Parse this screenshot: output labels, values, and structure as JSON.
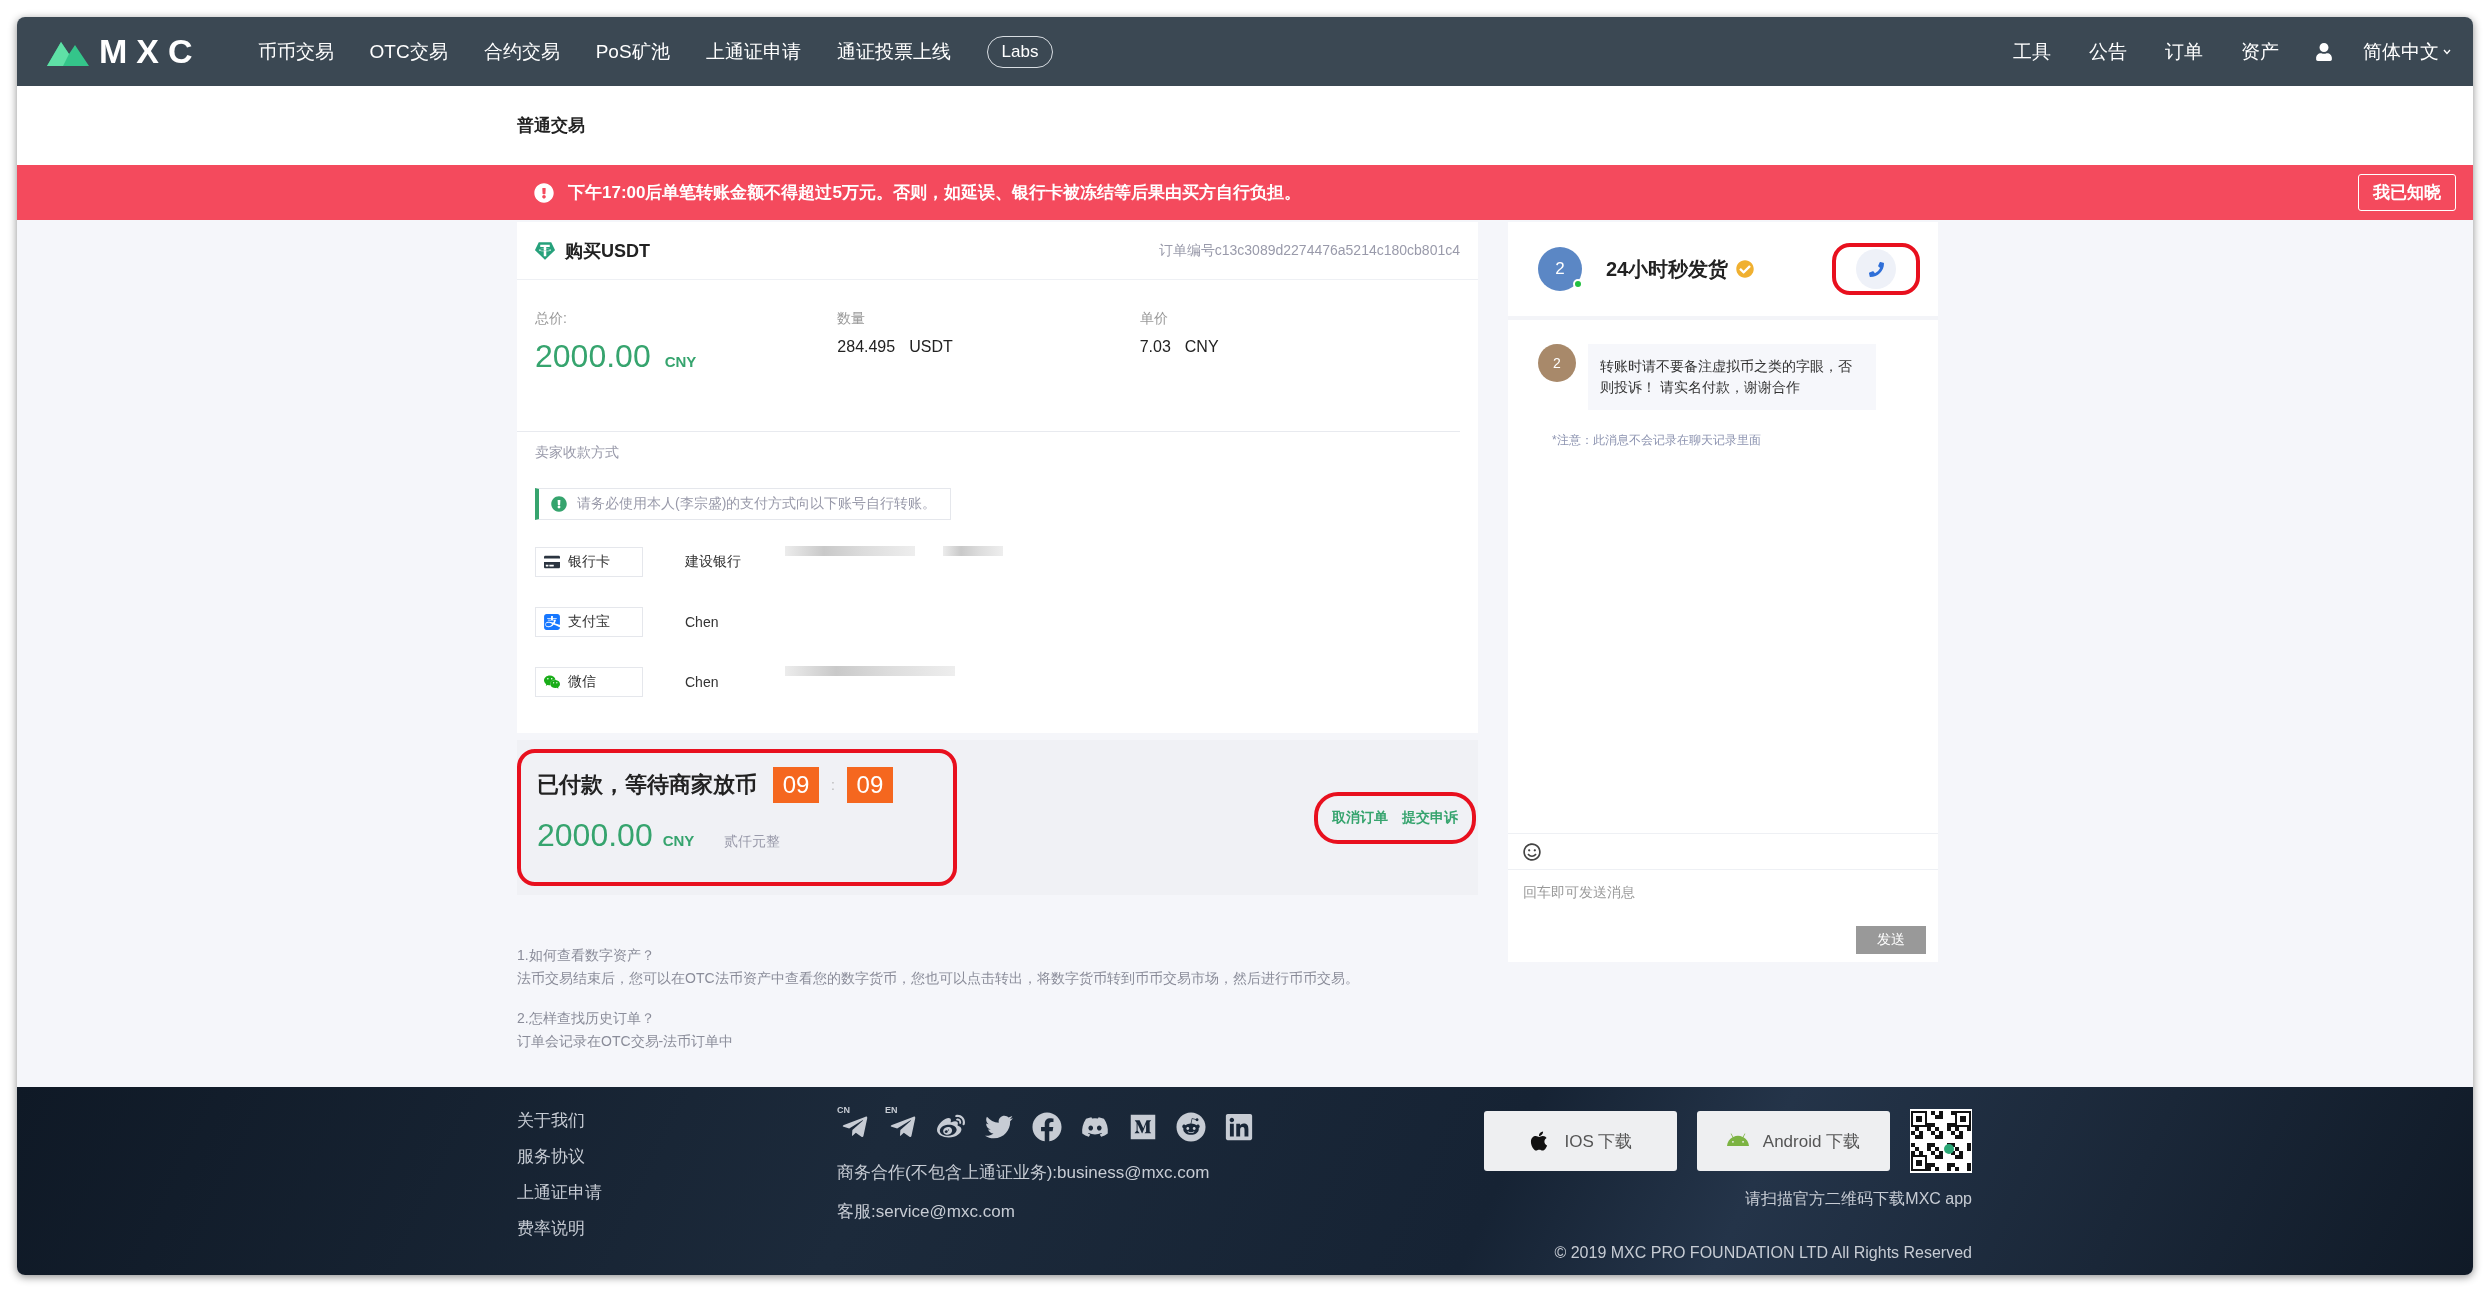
{
  "nav": {
    "logo": "MXC",
    "items": [
      "币币交易",
      "OTC交易",
      "合约交易",
      "PoS矿池",
      "上通证申请",
      "通证投票上线"
    ],
    "labs": "Labs",
    "right": [
      "工具",
      "公告",
      "订单",
      "资产"
    ],
    "language": "简体中文"
  },
  "breadcrumb": "普通交易",
  "notice": {
    "text": "下午17:00后单笔转账金额不得超过5万元。否则，如延误、银行卡被冻结等后果由买方自行负担。",
    "button": "我已知晓"
  },
  "order": {
    "title": "购买USDT",
    "order_no": "订单编号c13c3089d2274476a5214c180cb801c4",
    "stats": [
      {
        "kind": "highlight",
        "label": "总价:",
        "value": "2000.00",
        "unit": "CNY"
      },
      {
        "kind": "plain",
        "label": "数量",
        "value": "284.495",
        "unit": "USDT"
      },
      {
        "kind": "plain",
        "label": "单价",
        "value": "7.03",
        "unit": "CNY"
      }
    ],
    "methods_label": "卖家收款方式",
    "warning": "请务必使用本人(李宗盛)的支付方式向以下账号自行转账。",
    "methods": [
      {
        "kind": "bank",
        "label": "银行卡",
        "name": "建设银行"
      },
      {
        "kind": "alipay",
        "label": "支付宝",
        "name": "Chen"
      },
      {
        "kind": "wechat",
        "label": "微信",
        "name": "Chen"
      }
    ]
  },
  "status": {
    "title": "已付款，等待商家放币",
    "timer": [
      "09",
      "09"
    ],
    "separator": ":",
    "amount": "2000.00",
    "unit": "CNY",
    "amount_words": "贰仟元整",
    "highlighted": true,
    "actions": [
      "取消订单",
      "提交申诉"
    ],
    "actions_highlighted": true
  },
  "faq": [
    {
      "q": "1.如何查看数字资产？",
      "a": "法币交易结束后，您可以在OTC法币资产中查看您的数字货币，您也可以点击转出，将数字货币转到币币交易市场，然后进行币币交易。"
    },
    {
      "q": "2.怎样查找历史订单？",
      "a": "订单会记录在OTC交易-法币订单中"
    }
  ],
  "chat": {
    "avatar": "2",
    "online": true,
    "name": "24小时秒发货",
    "verified": true,
    "call_highlighted": true,
    "messages": [
      {
        "avatar": "2",
        "text": "转账时请不要备注虚拟币之类的字眼，否则投诉！ 请实名付款，谢谢合作"
      }
    ],
    "note": "*注意：此消息不会记录在聊天记录里面",
    "placeholder": "回车即可发送消息",
    "send": "发送"
  },
  "footer": {
    "links": [
      "关于我们",
      "服务协议",
      "上通证申请",
      "费率说明"
    ],
    "telegram_labels": [
      "CN",
      "EN"
    ],
    "business": "商务合作(不包含上通证业务):business@mxc.com",
    "service": "客服:service@mxc.com",
    "downloads": [
      {
        "kind": "ios",
        "label": "IOS 下载"
      },
      {
        "kind": "android",
        "label": "Android 下载"
      }
    ],
    "qr_caption": "请扫描官方二维码下载MXC app",
    "copyright": "© 2019 MXC PRO FOUNDATION LTD All Rights Reserved"
  }
}
